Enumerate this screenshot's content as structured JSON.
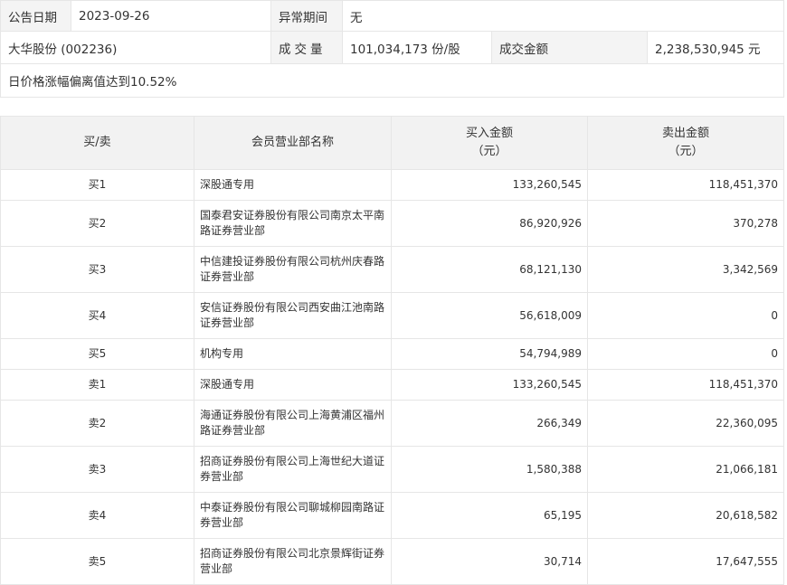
{
  "info": {
    "date_label": "公告日期",
    "date_value": "2023-09-26",
    "period_label": "异常期间",
    "period_value": "无",
    "stock": "大华股份 (002236)",
    "volume_label": "成交量",
    "volume_value": "101,034,173 份/股",
    "amount_label": "成交金额",
    "amount_value": "2,238,530,945 元",
    "reason": "日价格涨幅偏离值达到10.52%"
  },
  "table": {
    "headers": {
      "side": "买/卖",
      "broker": "会员营业部名称",
      "buy_line1": "买入金额",
      "buy_line2": "（元）",
      "sell_line1": "卖出金额",
      "sell_line2": "（元）"
    },
    "rows": [
      {
        "side": "买1",
        "broker": "深股通专用",
        "buy": "133,260,545",
        "sell": "118,451,370"
      },
      {
        "side": "买2",
        "broker": "国泰君安证券股份有限公司南京太平南路证券营业部",
        "buy": "86,920,926",
        "sell": "370,278"
      },
      {
        "side": "买3",
        "broker": "中信建投证券股份有限公司杭州庆春路证券营业部",
        "buy": "68,121,130",
        "sell": "3,342,569"
      },
      {
        "side": "买4",
        "broker": "安信证券股份有限公司西安曲江池南路证券营业部",
        "buy": "56,618,009",
        "sell": "0"
      },
      {
        "side": "买5",
        "broker": "机构专用",
        "buy": "54,794,989",
        "sell": "0"
      },
      {
        "side": "卖1",
        "broker": "深股通专用",
        "buy": "133,260,545",
        "sell": "118,451,370"
      },
      {
        "side": "卖2",
        "broker": "海通证券股份有限公司上海黄浦区福州路证券营业部",
        "buy": "266,349",
        "sell": "22,360,095"
      },
      {
        "side": "卖3",
        "broker": "招商证券股份有限公司上海世纪大道证券营业部",
        "buy": "1,580,388",
        "sell": "21,066,181"
      },
      {
        "side": "卖4",
        "broker": "中泰证券股份有限公司聊城柳园南路证券营业部",
        "buy": "65,195",
        "sell": "20,618,582"
      },
      {
        "side": "卖5",
        "broker": "招商证券股份有限公司北京景辉街证券营业部",
        "buy": "30,714",
        "sell": "17,647,555"
      }
    ]
  }
}
